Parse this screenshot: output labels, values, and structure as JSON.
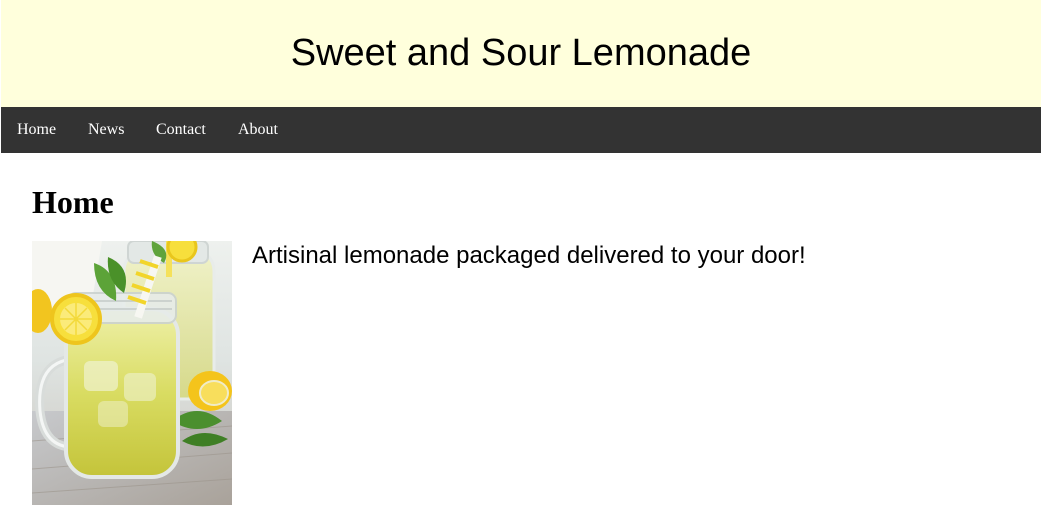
{
  "header": {
    "title": "Sweet and Sour Lemonade"
  },
  "nav": {
    "items": [
      {
        "label": "Home"
      },
      {
        "label": "News"
      },
      {
        "label": "Contact"
      },
      {
        "label": "About"
      }
    ]
  },
  "main": {
    "heading": "Home",
    "description": "Artisinal lemonade packaged delivered to your door!",
    "image": {
      "subject": "glass jar of lemonade with lemon slice, mint leaves and yellow-striped straw"
    }
  },
  "colors": {
    "banner_background": "#ffffdc",
    "nav_background": "#333333",
    "nav_text": "#ffffff",
    "text": "#000000"
  }
}
